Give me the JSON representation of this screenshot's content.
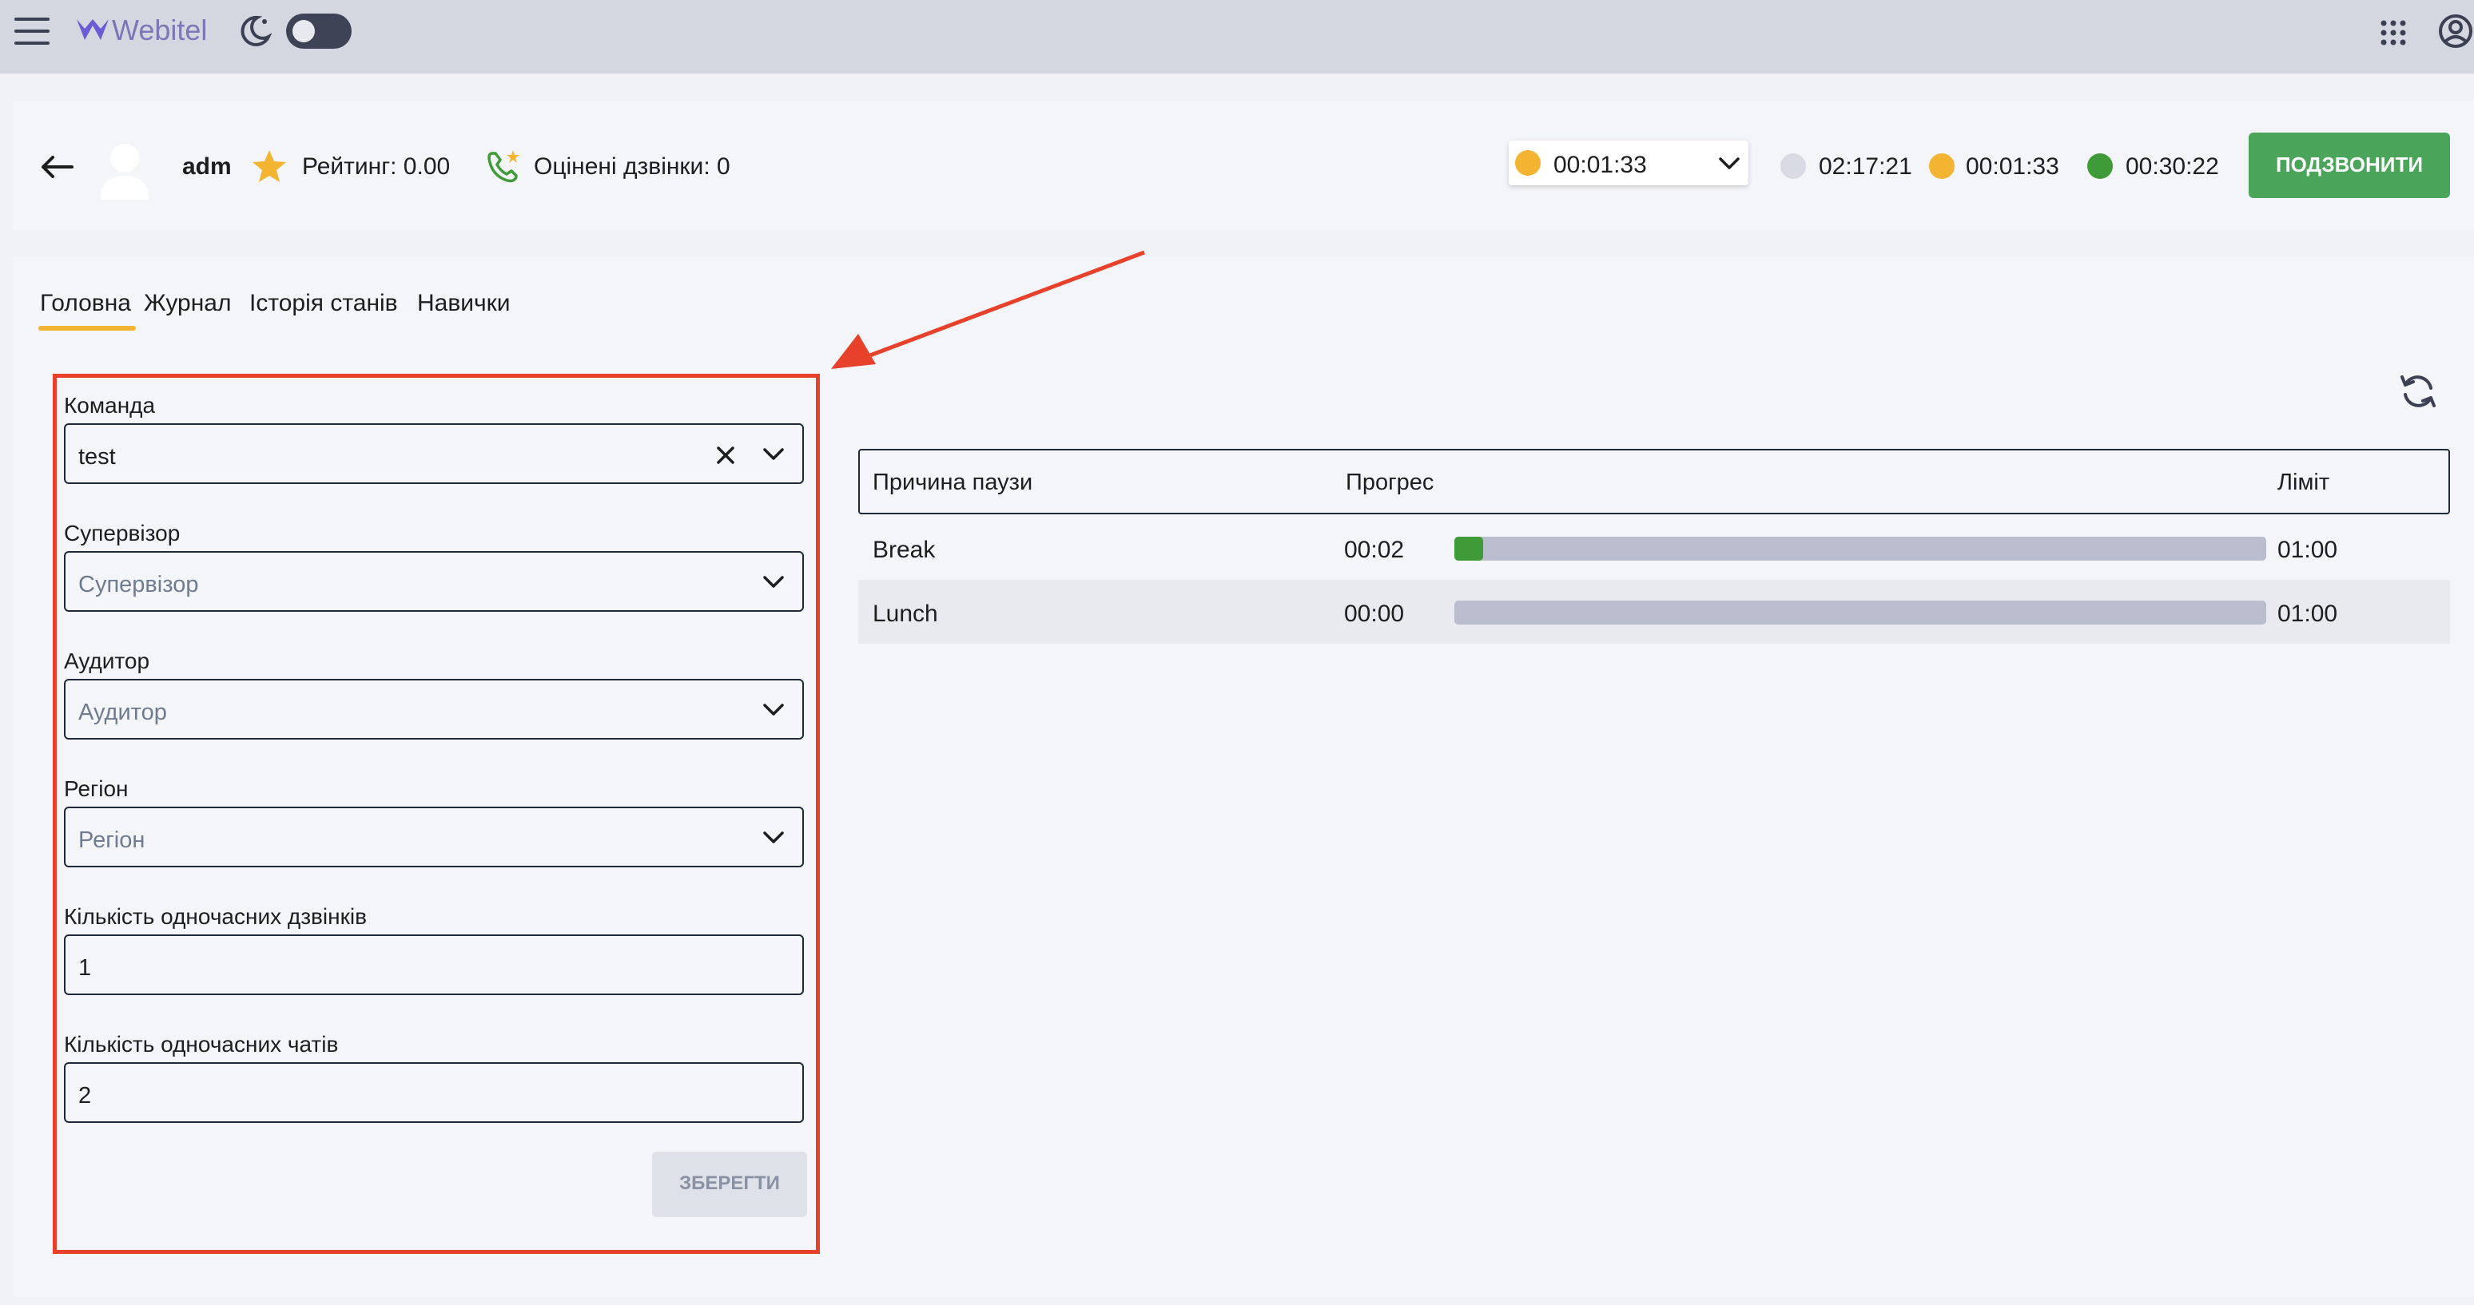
{
  "header": {
    "brand": "Webitel",
    "theme_toggle_on": false
  },
  "agent": {
    "name": "adm",
    "rating": "Рейтинг: 0.00",
    "rated_calls": "Оцінені дзвінки: 0",
    "status_selected": "00:01:33",
    "timers": [
      "02:17:21",
      "00:01:33",
      "00:30:22"
    ],
    "call_button": "ПОДЗВОНИТИ"
  },
  "colors": {
    "status_pause": "#f2b431",
    "status_offline": "#d8dbe4",
    "status_online": "#3f9b38",
    "accent_tab": "#f2b431",
    "call_button": "#4aa45a",
    "annotation": "#e8412b"
  },
  "tabs": [
    "Головна",
    "Журнал",
    "Історія станів",
    "Навички"
  ],
  "active_tab": 0,
  "form": {
    "team_label": "Команда",
    "team_value": "test",
    "supervisor_label": "Супервізор",
    "supervisor_placeholder": "Супервізор",
    "auditor_label": "Аудитор",
    "auditor_placeholder": "Аудитор",
    "region_label": "Регіон",
    "region_placeholder": "Регіон",
    "calls_label": "Кількість одночасних дзвінків",
    "calls_value": "1",
    "chats_label": "Кількість одночасних чатів",
    "chats_value": "2",
    "save_button": "ЗБЕРЕГТИ"
  },
  "pause_table": {
    "headers": [
      "Причина паузи",
      "Прогрес",
      "Ліміт"
    ],
    "rows": [
      {
        "reason": "Break",
        "elapsed": "00:02",
        "progress": 0.033,
        "limit": "01:00"
      },
      {
        "reason": "Lunch",
        "elapsed": "00:00",
        "progress": 0.0,
        "limit": "01:00"
      }
    ]
  }
}
